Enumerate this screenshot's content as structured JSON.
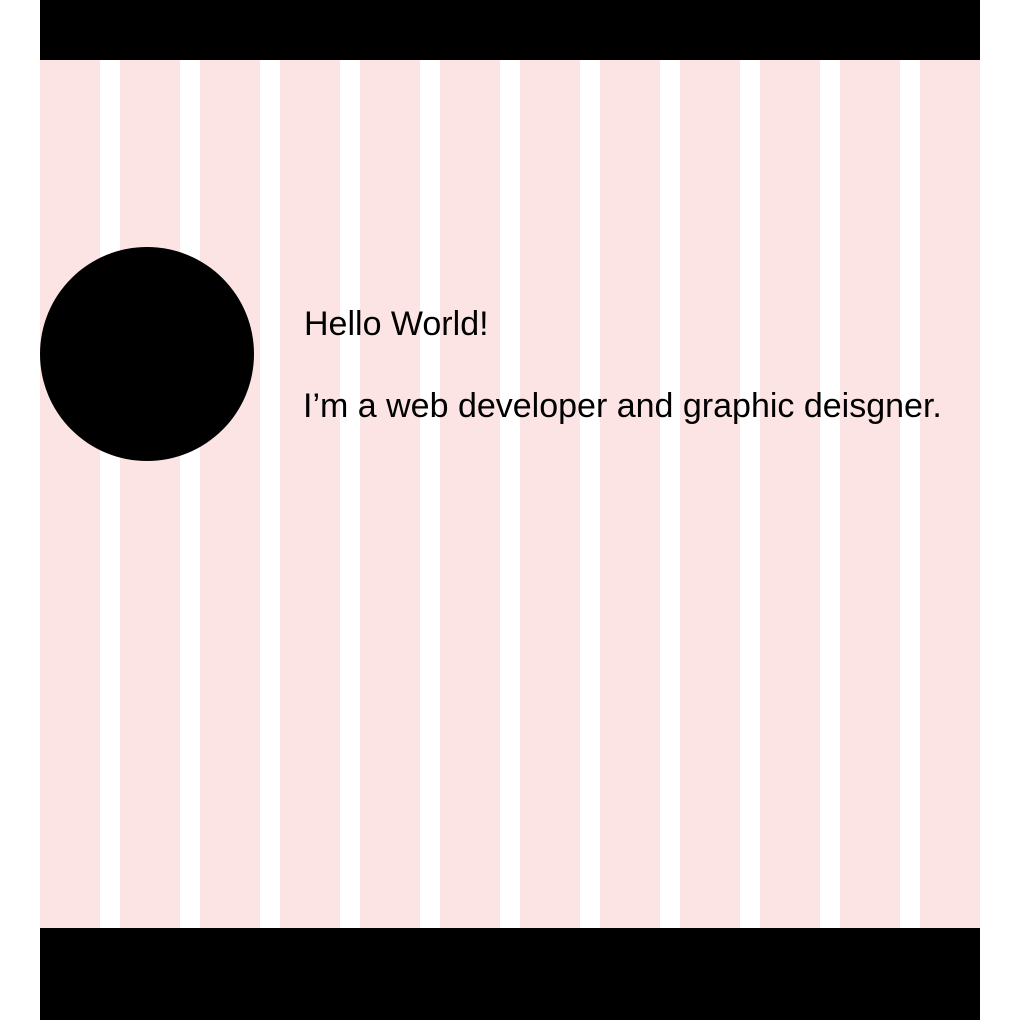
{
  "page": {
    "greeting": "Hello World!",
    "tagline": "I’m a web developer and graphic deisgner."
  },
  "colors": {
    "grid_column": "#fde4e4",
    "bars": "#000000",
    "avatar": "#000000",
    "text": "#000000",
    "background": "#ffffff"
  }
}
